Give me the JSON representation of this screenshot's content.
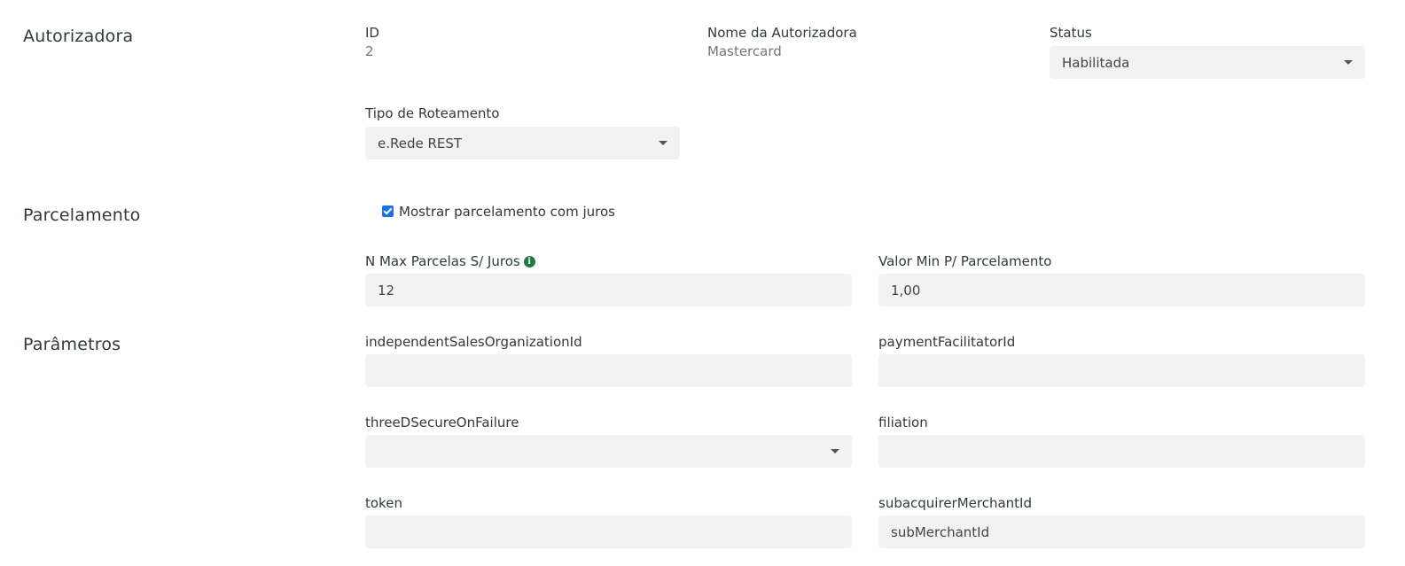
{
  "autorizadora": {
    "section_title": "Autorizadora",
    "id_label": "ID",
    "id_value": "2",
    "name_label": "Nome da Autorizadora",
    "name_value": "Mastercard",
    "status_label": "Status",
    "status_value": "Habilitada",
    "routing_label": "Tipo de Roteamento",
    "routing_value": "e.Rede REST"
  },
  "parcelamento": {
    "section_title": "Parcelamento",
    "checkbox_label": "Mostrar parcelamento com juros",
    "checkbox_checked": true,
    "max_label": "N Max Parcelas S/ Juros",
    "info_glyph": "i",
    "max_value": "12",
    "min_label": "Valor Min P/ Parcelamento",
    "min_value": "1,00"
  },
  "parametros": {
    "section_title": "Parâmetros",
    "iso_label": "independentSalesOrganizationId",
    "iso_value": "",
    "pf_label": "paymentFacilitatorId",
    "pf_value": "",
    "tds_label": "threeDSecureOnFailure",
    "tds_value": "",
    "filiation_label": "filiation",
    "filiation_value": "",
    "token_label": "token",
    "token_value": "",
    "sub_label": "subacquirerMerchantId",
    "sub_value": "subMerchantId"
  },
  "colors": {
    "checkbox": "#1a73e8",
    "info_icon": "#1e7a45",
    "field_bg": "#f2f2f2"
  }
}
